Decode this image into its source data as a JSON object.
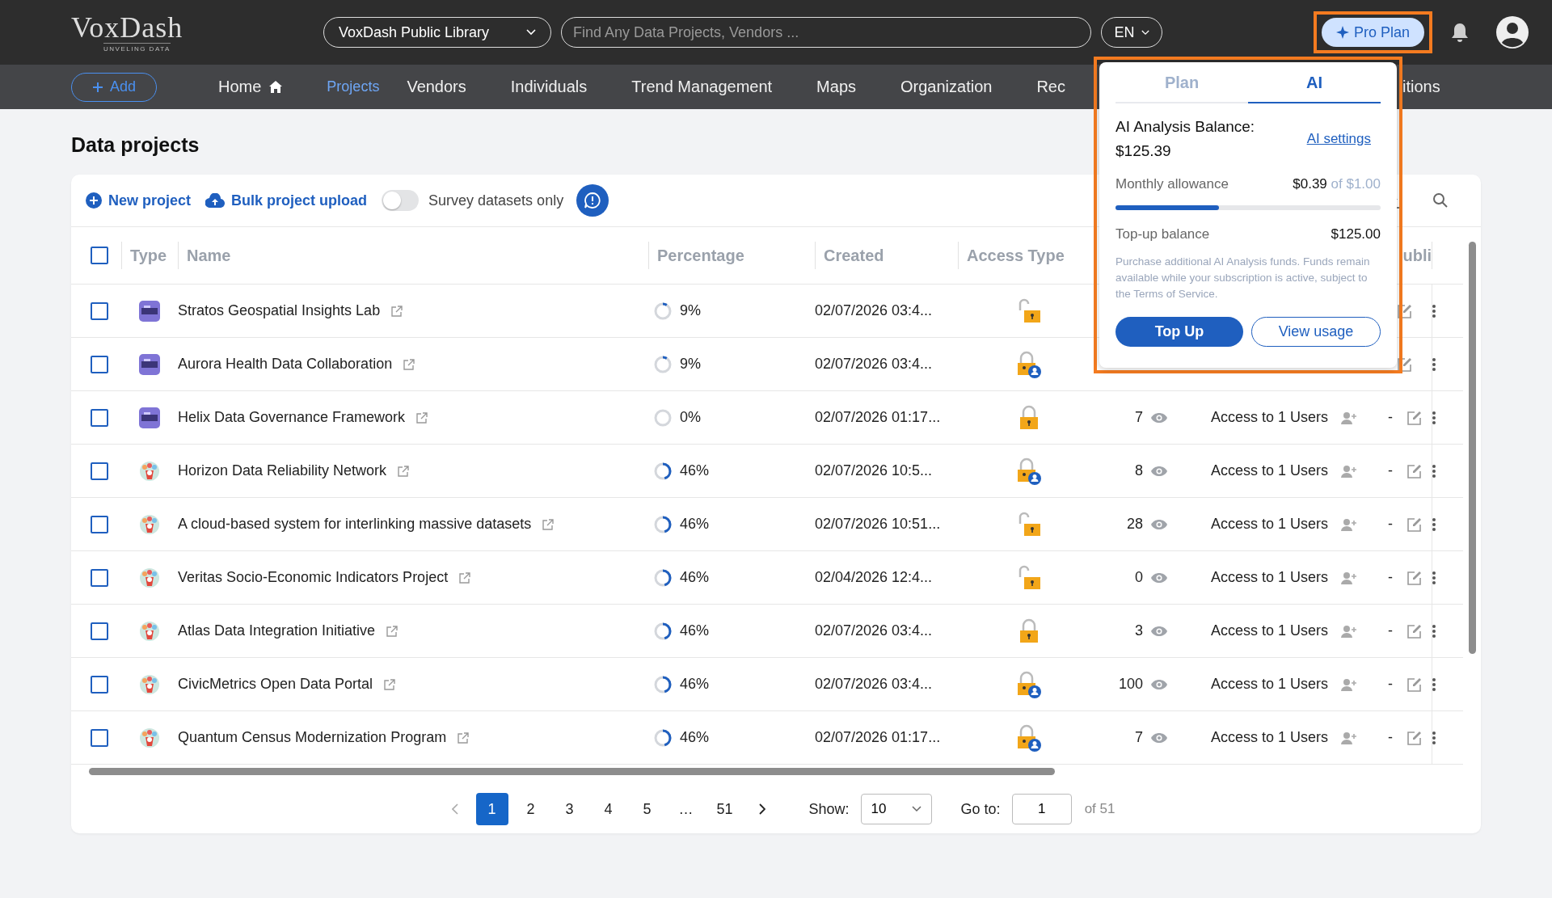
{
  "header": {
    "logo": "VoxDash",
    "tagline": "UNVELING DATA",
    "library_select": "VoxDash Public Library",
    "search": {
      "placeholder": "Find Any Data Projects, Vendors ..."
    },
    "language": "EN",
    "plan_button": "Pro Plan"
  },
  "nav": {
    "add_button": "Add",
    "items": [
      {
        "label": "Home",
        "selected": false
      },
      {
        "label": "Projects",
        "selected": true
      },
      {
        "label": "Vendors",
        "selected": false
      },
      {
        "label": "Individuals",
        "selected": false
      },
      {
        "label": "Trend Management",
        "selected": false
      },
      {
        "label": "Maps",
        "selected": false
      },
      {
        "label": "Organization",
        "selected": false
      },
      {
        "label": "Rec",
        "selected": false
      },
      {
        "label": "itions",
        "selected": false
      }
    ]
  },
  "page_title": "Data projects",
  "toolbar": {
    "new_project": "New project",
    "bulk_upload": "Bulk project upload",
    "survey_toggle": {
      "label": "Survey datasets only",
      "on": false
    }
  },
  "table": {
    "select_all": {
      "checked": false
    },
    "columns": [
      "Type",
      "Name",
      "Percentage",
      "Created",
      "Access Type",
      "ubli"
    ],
    "rows": [
      {
        "checked": false,
        "type_icon": {
          "kind": "dataset"
        },
        "name": "Stratos Geospatial Insights Lab",
        "level": 0.09,
        "percentage": "9%",
        "created": "02/07/2026 03:4...",
        "access_icon": {
          "kind": "open"
        }
      },
      {
        "checked": false,
        "type_icon": {
          "kind": "dataset"
        },
        "name": "Aurora Health Data Collaboration",
        "level": 0.09,
        "percentage": "9%",
        "created": "02/07/2026 03:4...",
        "access_icon": {
          "kind": "locked-user"
        }
      },
      {
        "checked": false,
        "type_icon": {
          "kind": "dataset"
        },
        "name": "Helix Data Governance Framework",
        "level": 0,
        "percentage": "0%",
        "created": "02/07/2026 01:17...",
        "access_icon": {
          "kind": "locked"
        },
        "views": "7",
        "users": "Access to 1 Users",
        "publish": "-"
      },
      {
        "checked": false,
        "type_icon": {
          "kind": "survey"
        },
        "name": "Horizon Data Reliability Network",
        "level": 0.46,
        "percentage": "46%",
        "created": "02/07/2026 10:5...",
        "access_icon": {
          "kind": "locked-user"
        },
        "views": "8",
        "users": "Access to 1 Users",
        "publish": "-"
      },
      {
        "checked": false,
        "type_icon": {
          "kind": "survey"
        },
        "name": "A cloud-based system for interlinking massive datasets",
        "level": 0.46,
        "percentage": "46%",
        "created": "02/07/2026 10:51...",
        "access_icon": {
          "kind": "open"
        },
        "views": "28",
        "users": "Access to 1 Users",
        "publish": "-"
      },
      {
        "checked": false,
        "type_icon": {
          "kind": "survey"
        },
        "name": "Veritas Socio-Economic Indicators Project",
        "level": 0.46,
        "percentage": "46%",
        "created": "02/04/2026 12:4...",
        "access_icon": {
          "kind": "open"
        },
        "views": "0",
        "users": "Access to 1 Users",
        "publish": "-"
      },
      {
        "checked": false,
        "type_icon": {
          "kind": "survey"
        },
        "name": "Atlas Data Integration Initiative",
        "level": 0.46,
        "percentage": "46%",
        "created": "02/07/2026 03:4...",
        "access_icon": {
          "kind": "locked"
        },
        "views": "3",
        "users": "Access to 1 Users",
        "publish": "-"
      },
      {
        "checked": false,
        "type_icon": {
          "kind": "survey"
        },
        "name": "CivicMetrics Open Data Portal",
        "level": 0.46,
        "percentage": "46%",
        "created": "02/07/2026 03:4...",
        "access_icon": {
          "kind": "locked-user"
        },
        "views": "100",
        "users": "Access to 1 Users",
        "publish": "-"
      },
      {
        "checked": false,
        "type_icon": {
          "kind": "survey"
        },
        "name": "Quantum Census Modernization Program",
        "level": 0.46,
        "percentage": "46%",
        "created": "02/07/2026 01:17...",
        "access_icon": {
          "kind": "locked-user"
        },
        "views": "7",
        "users": "Access to 1 Users",
        "publish": "-"
      }
    ]
  },
  "pagination": {
    "pages": [
      {
        "label": "1",
        "selected": true
      },
      {
        "label": "2",
        "selected": false
      },
      {
        "label": "3",
        "selected": false
      },
      {
        "label": "4",
        "selected": false
      },
      {
        "label": "5",
        "selected": false
      },
      {
        "label": "…",
        "selected": false
      },
      {
        "label": "51",
        "selected": false
      }
    ],
    "show_label": "Show:",
    "page_size": "10",
    "goto_label": "Go to:",
    "goto_value": "1",
    "total": "of 51"
  },
  "popup": {
    "tabs": [
      {
        "label": "Plan",
        "selected": false
      },
      {
        "label": "AI",
        "selected": true
      }
    ],
    "balance_label": "AI Analysis Balance:",
    "balance": "$125.39",
    "settings_link": "AI settings",
    "allowance_label": "Monthly allowance",
    "allowance_used": "$0.39",
    "allowance_total": "of $1.00",
    "level": 0.39,
    "topup_label": "Top-up balance",
    "topup_value": "$125.00",
    "note": "Purchase additional AI Analysis funds. Funds remain available while your subscription is active, subject to the Terms of Service.",
    "buttons": [
      "Top Up",
      "View usage"
    ]
  }
}
